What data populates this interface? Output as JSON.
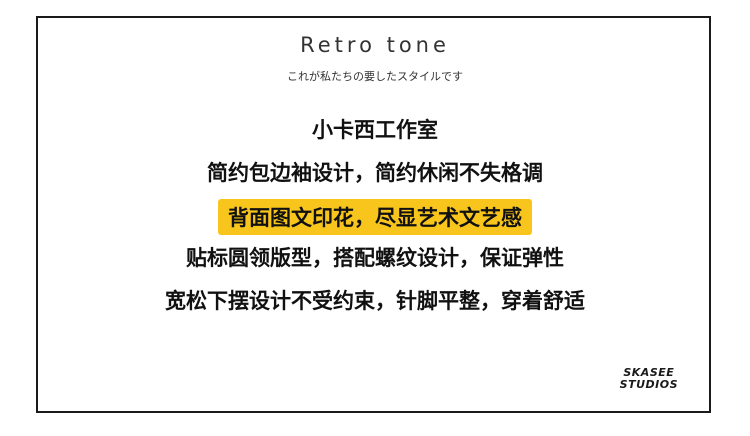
{
  "title": "Retro tone",
  "subtitle": "これが私たちの要したスタイルです",
  "lines": [
    "小卡西工作室",
    "简约包边袖设计，简约休闲不失格调",
    "背面图文印花，尽显艺术文艺感",
    "贴标圆领版型，搭配螺纹设计，保证弹性",
    "宽松下摆设计不受约束，针脚平整，穿着舒适"
  ],
  "highlight_color": "#f7c51c",
  "logo": {
    "line1": "SKASEE",
    "line2": "STUDIOS"
  }
}
